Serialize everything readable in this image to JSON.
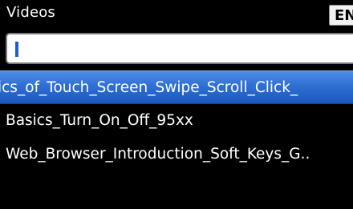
{
  "header": {
    "title": "Videos",
    "input_language": "EN"
  },
  "search": {
    "value": "",
    "placeholder": ""
  },
  "videos": {
    "items": [
      {
        "label": "ics_of_Touch_Screen_Swipe_Scroll_Click_",
        "selected": true
      },
      {
        "label": "Basics_Turn_On_Off_95xx",
        "selected": false
      },
      {
        "label": "Web_Browser_Introduction_Soft_Keys_G..",
        "selected": false
      }
    ]
  },
  "colors": {
    "background": "#000000",
    "selection": "#2f6fd3",
    "caret": "#1f5ccf",
    "text": "#ffffff"
  }
}
